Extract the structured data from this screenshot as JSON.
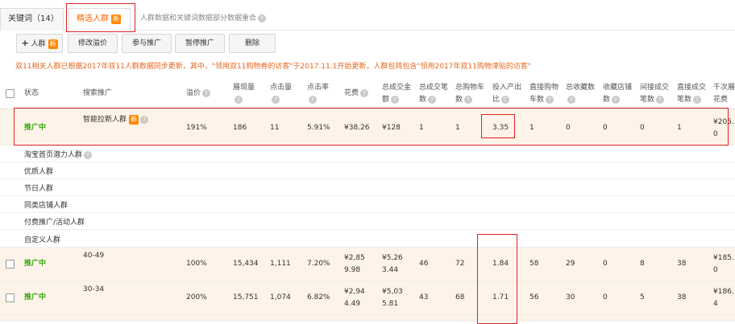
{
  "tabs": {
    "keywords": "关键词（14）",
    "crowds": "精选人群",
    "new_badge": "新",
    "note": "人群数据和关键词数据部分数据重合"
  },
  "toolbar": {
    "add_crowd": "人群",
    "add_badge": "新",
    "edit_premium": "修改溢价",
    "join_promo": "参与推广",
    "pause_promo": "暂停推广",
    "delete": "删除"
  },
  "notice": "双11相关人群已根据2017年双11人群数据同步更新，其中，\"领用双11购物券的访客\"于2017.11.1开始更新，人群包将包含\"领用2017年双11购物津贴的访客\"",
  "columns": {
    "status": "状态",
    "search_promo": "搜索推广",
    "premium": "溢价",
    "impressions": "展现量",
    "clicks": "点击量",
    "ctr": "点击率",
    "cost": "花费",
    "total_gmv_1": "总成交金",
    "total_gmv_2": "额",
    "total_orders_1": "总成交笔",
    "total_orders_2": "数",
    "total_cart_1": "总购物车",
    "total_cart_2": "数",
    "roi_1": "投入产出",
    "roi_2": "比",
    "direct_cart_1": "直接购物",
    "direct_cart_2": "车数",
    "fav_items": "总收藏数",
    "fav_store_1": "收藏店铺",
    "fav_store_2": "数",
    "indirect_orders_1": "间接成交",
    "indirect_orders_2": "笔数",
    "direct_orders_1": "直接成交",
    "direct_orders_2": "笔数",
    "cpm_1": "千次展",
    "cpm_2": "花费"
  },
  "row1": {
    "status": "推广中",
    "name": "智能拉新人群",
    "badge": "新",
    "premium": "191%",
    "impressions": "186",
    "clicks": "11",
    "ctr": "5.91%",
    "cost": "¥38.26",
    "gmv": "¥128",
    "orders": "1",
    "cart": "1",
    "roi": "3.35",
    "direct_cart": "1",
    "fav_items": "0",
    "fav_store": "0",
    "indirect_orders": "0",
    "direct_orders": "1",
    "cpm_1": "¥205.",
    "cpm_2": "0"
  },
  "crowd_groups": [
    "淘宝首页潜力人群",
    "优质人群",
    "节日人群",
    "同类店铺人群",
    "付费推广/活动人群",
    "自定义人群"
  ],
  "row2": {
    "status": "推广中",
    "name": "40-49",
    "premium": "100%",
    "impressions": "15,434",
    "clicks": "1,111",
    "ctr": "7.20%",
    "cost_1": "¥2,85",
    "cost_2": "9.98",
    "gmv_1": "¥5,26",
    "gmv_2": "3.44",
    "orders": "46",
    "cart": "72",
    "roi": "1.84",
    "direct_cart": "58",
    "fav_items": "29",
    "fav_store": "0",
    "indirect_orders": "8",
    "direct_orders": "38",
    "cpm_1": "¥185.",
    "cpm_2": "0"
  },
  "row3": {
    "status": "推广中",
    "name": "30-34",
    "premium": "200%",
    "impressions": "15,751",
    "clicks": "1,074",
    "ctr": "6.82%",
    "cost_1": "¥2,94",
    "cost_2": "4.49",
    "gmv_1": "¥5,03",
    "gmv_2": "5.81",
    "orders": "43",
    "cart": "68",
    "roi": "1.71",
    "direct_cart": "56",
    "fav_items": "30",
    "fav_store": "0",
    "indirect_orders": "5",
    "direct_orders": "38",
    "cpm_1": "¥186.",
    "cpm_2": "4"
  },
  "help_glyph": "?",
  "plus_glyph": "+"
}
